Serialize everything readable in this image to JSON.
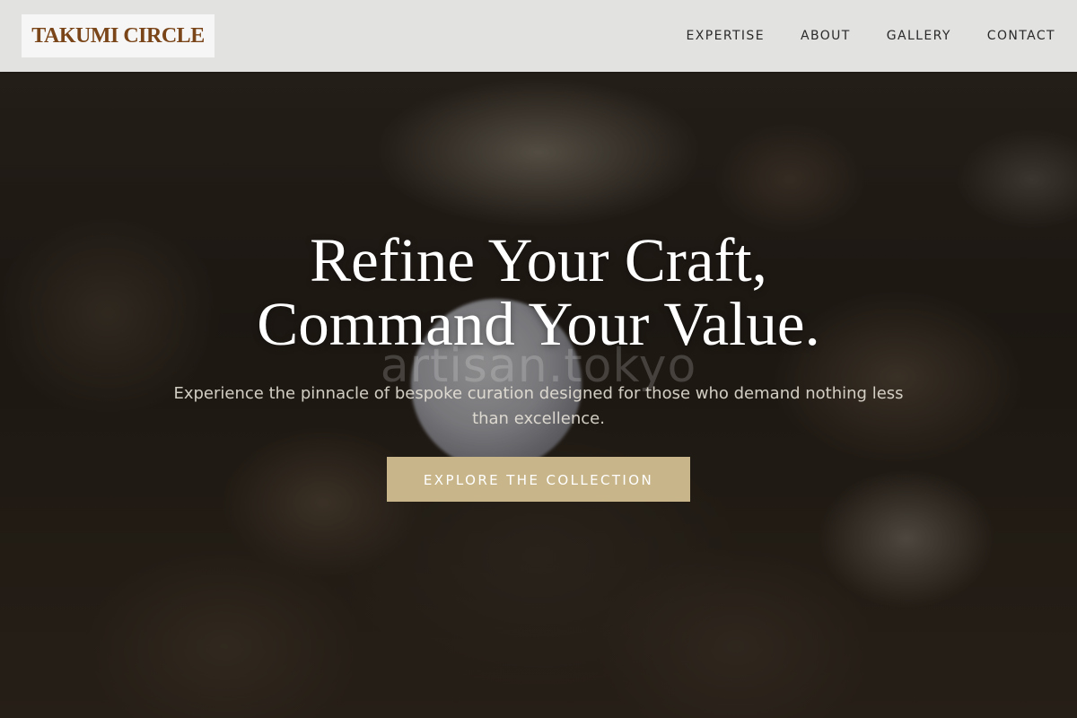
{
  "header": {
    "logo_text": "TAKUMI CIRCLE",
    "nav": [
      {
        "label": "EXPERTISE"
      },
      {
        "label": "ABOUT"
      },
      {
        "label": "GALLERY"
      },
      {
        "label": "CONTACT"
      }
    ]
  },
  "hero": {
    "title_line1": "Refine Your Craft,",
    "title_line2": "Command Your Value.",
    "watermark": "artisan.tokyo",
    "subtitle": "Experience the pinnacle of bespoke curation designed for those who demand nothing less than excellence.",
    "cta_label": "EXPLORE THE COLLECTION"
  },
  "colors": {
    "logo_text": "#7a4518",
    "header_bg": "#e8e8e8",
    "cta_bg": "#c8b68a",
    "title_text": "#ffffff"
  }
}
